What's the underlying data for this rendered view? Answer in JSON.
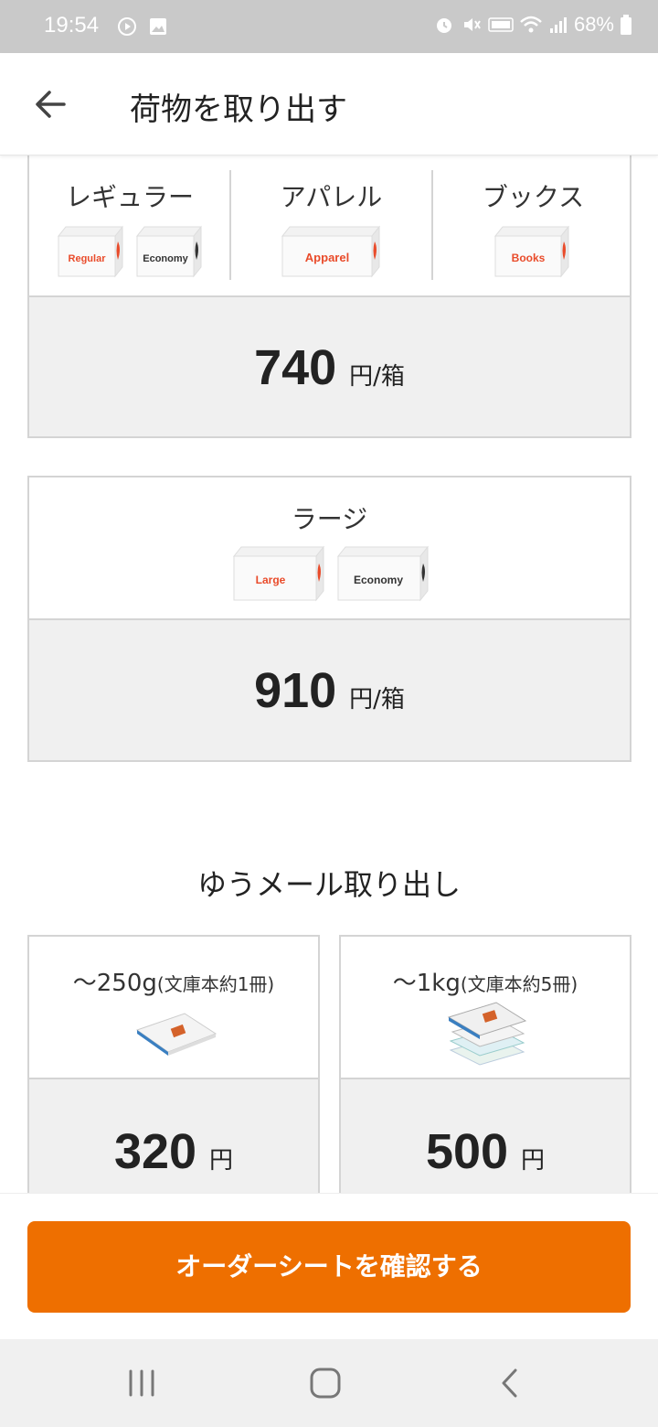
{
  "status_bar": {
    "time": "19:54",
    "battery": "68%",
    "icons": [
      "play-icon",
      "image-icon",
      "alarm-icon",
      "mute-icon",
      "volte-icon",
      "wifi-icon",
      "signal-icon",
      "battery-icon"
    ]
  },
  "header": {
    "title": "荷物を取り出す",
    "back_icon": "arrow-left-icon"
  },
  "box_plans": [
    {
      "columns": [
        {
          "label": "レギュラー",
          "boxes": [
            "Regular",
            "Economy"
          ]
        },
        {
          "label": "アパレル",
          "boxes": [
            "Apparel"
          ]
        },
        {
          "label": "ブックス",
          "boxes": [
            "Books"
          ]
        }
      ],
      "price": "740",
      "unit": "円/箱"
    },
    {
      "columns": [
        {
          "label": "ラージ",
          "boxes": [
            "Large",
            "Economy"
          ]
        }
      ],
      "price": "910",
      "unit": "円/箱"
    }
  ],
  "yumail": {
    "title": "ゆうメール取り出し",
    "options": [
      {
        "weight": "〜250g",
        "note": "(文庫本約1冊)",
        "price": "320",
        "unit": "円"
      },
      {
        "weight": "〜1kg",
        "note": "(文庫本約5冊)",
        "price": "500",
        "unit": "円"
      }
    ]
  },
  "cta": {
    "label": "オーダーシートを確認する"
  },
  "colors": {
    "accent": "#ee6f00",
    "border": "#d4d4d4",
    "price_bg": "#f0f0f0",
    "status_bar": "#c9c9c9"
  },
  "nav": {
    "icons": [
      "recent-apps-icon",
      "home-icon",
      "back-icon"
    ]
  }
}
